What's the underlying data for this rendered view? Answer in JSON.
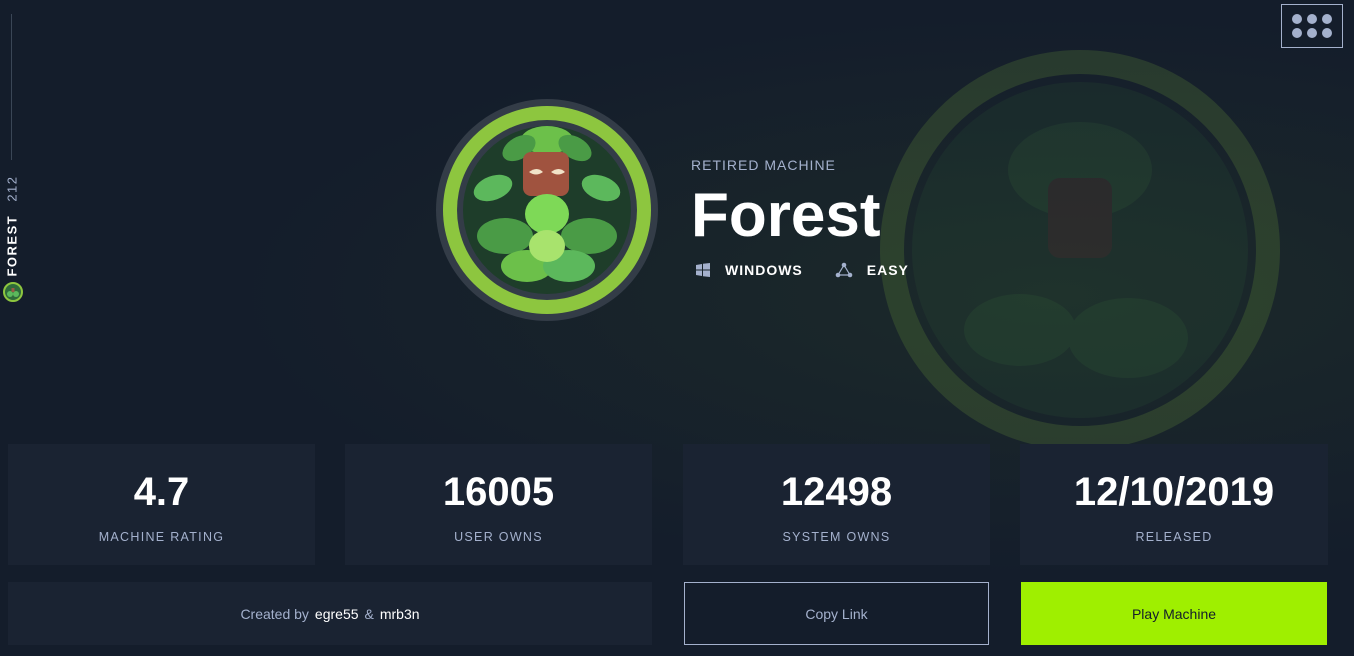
{
  "sidebar": {
    "machine_name": "FOREST",
    "machine_count": "212",
    "avatar_icon": "forest-avatar-icon"
  },
  "header": {
    "menu_icon": "grid-menu-icon"
  },
  "machine": {
    "status": "RETIRED MACHINE",
    "name": "Forest",
    "os": "WINDOWS",
    "os_icon": "windows-icon",
    "difficulty": "EASY",
    "difficulty_icon": "difficulty-icon"
  },
  "stats": {
    "rating": {
      "value": "4.7",
      "label": "MACHINE RATING"
    },
    "user_owns": {
      "value": "16005",
      "label": "USER OWNS"
    },
    "system_owns": {
      "value": "12498",
      "label": "SYSTEM OWNS"
    },
    "released": {
      "value": "12/10/2019",
      "label": "RELEASED"
    }
  },
  "creators": {
    "prefix": "Created by",
    "creator1": "egre55",
    "separator": "&",
    "creator2": "mrb3n"
  },
  "actions": {
    "copy_link": "Copy Link",
    "play_machine": "Play Machine"
  },
  "colors": {
    "background": "#141d2b",
    "card": "#1a2332",
    "accent": "#9fef00",
    "muted": "#a4b1cd"
  }
}
